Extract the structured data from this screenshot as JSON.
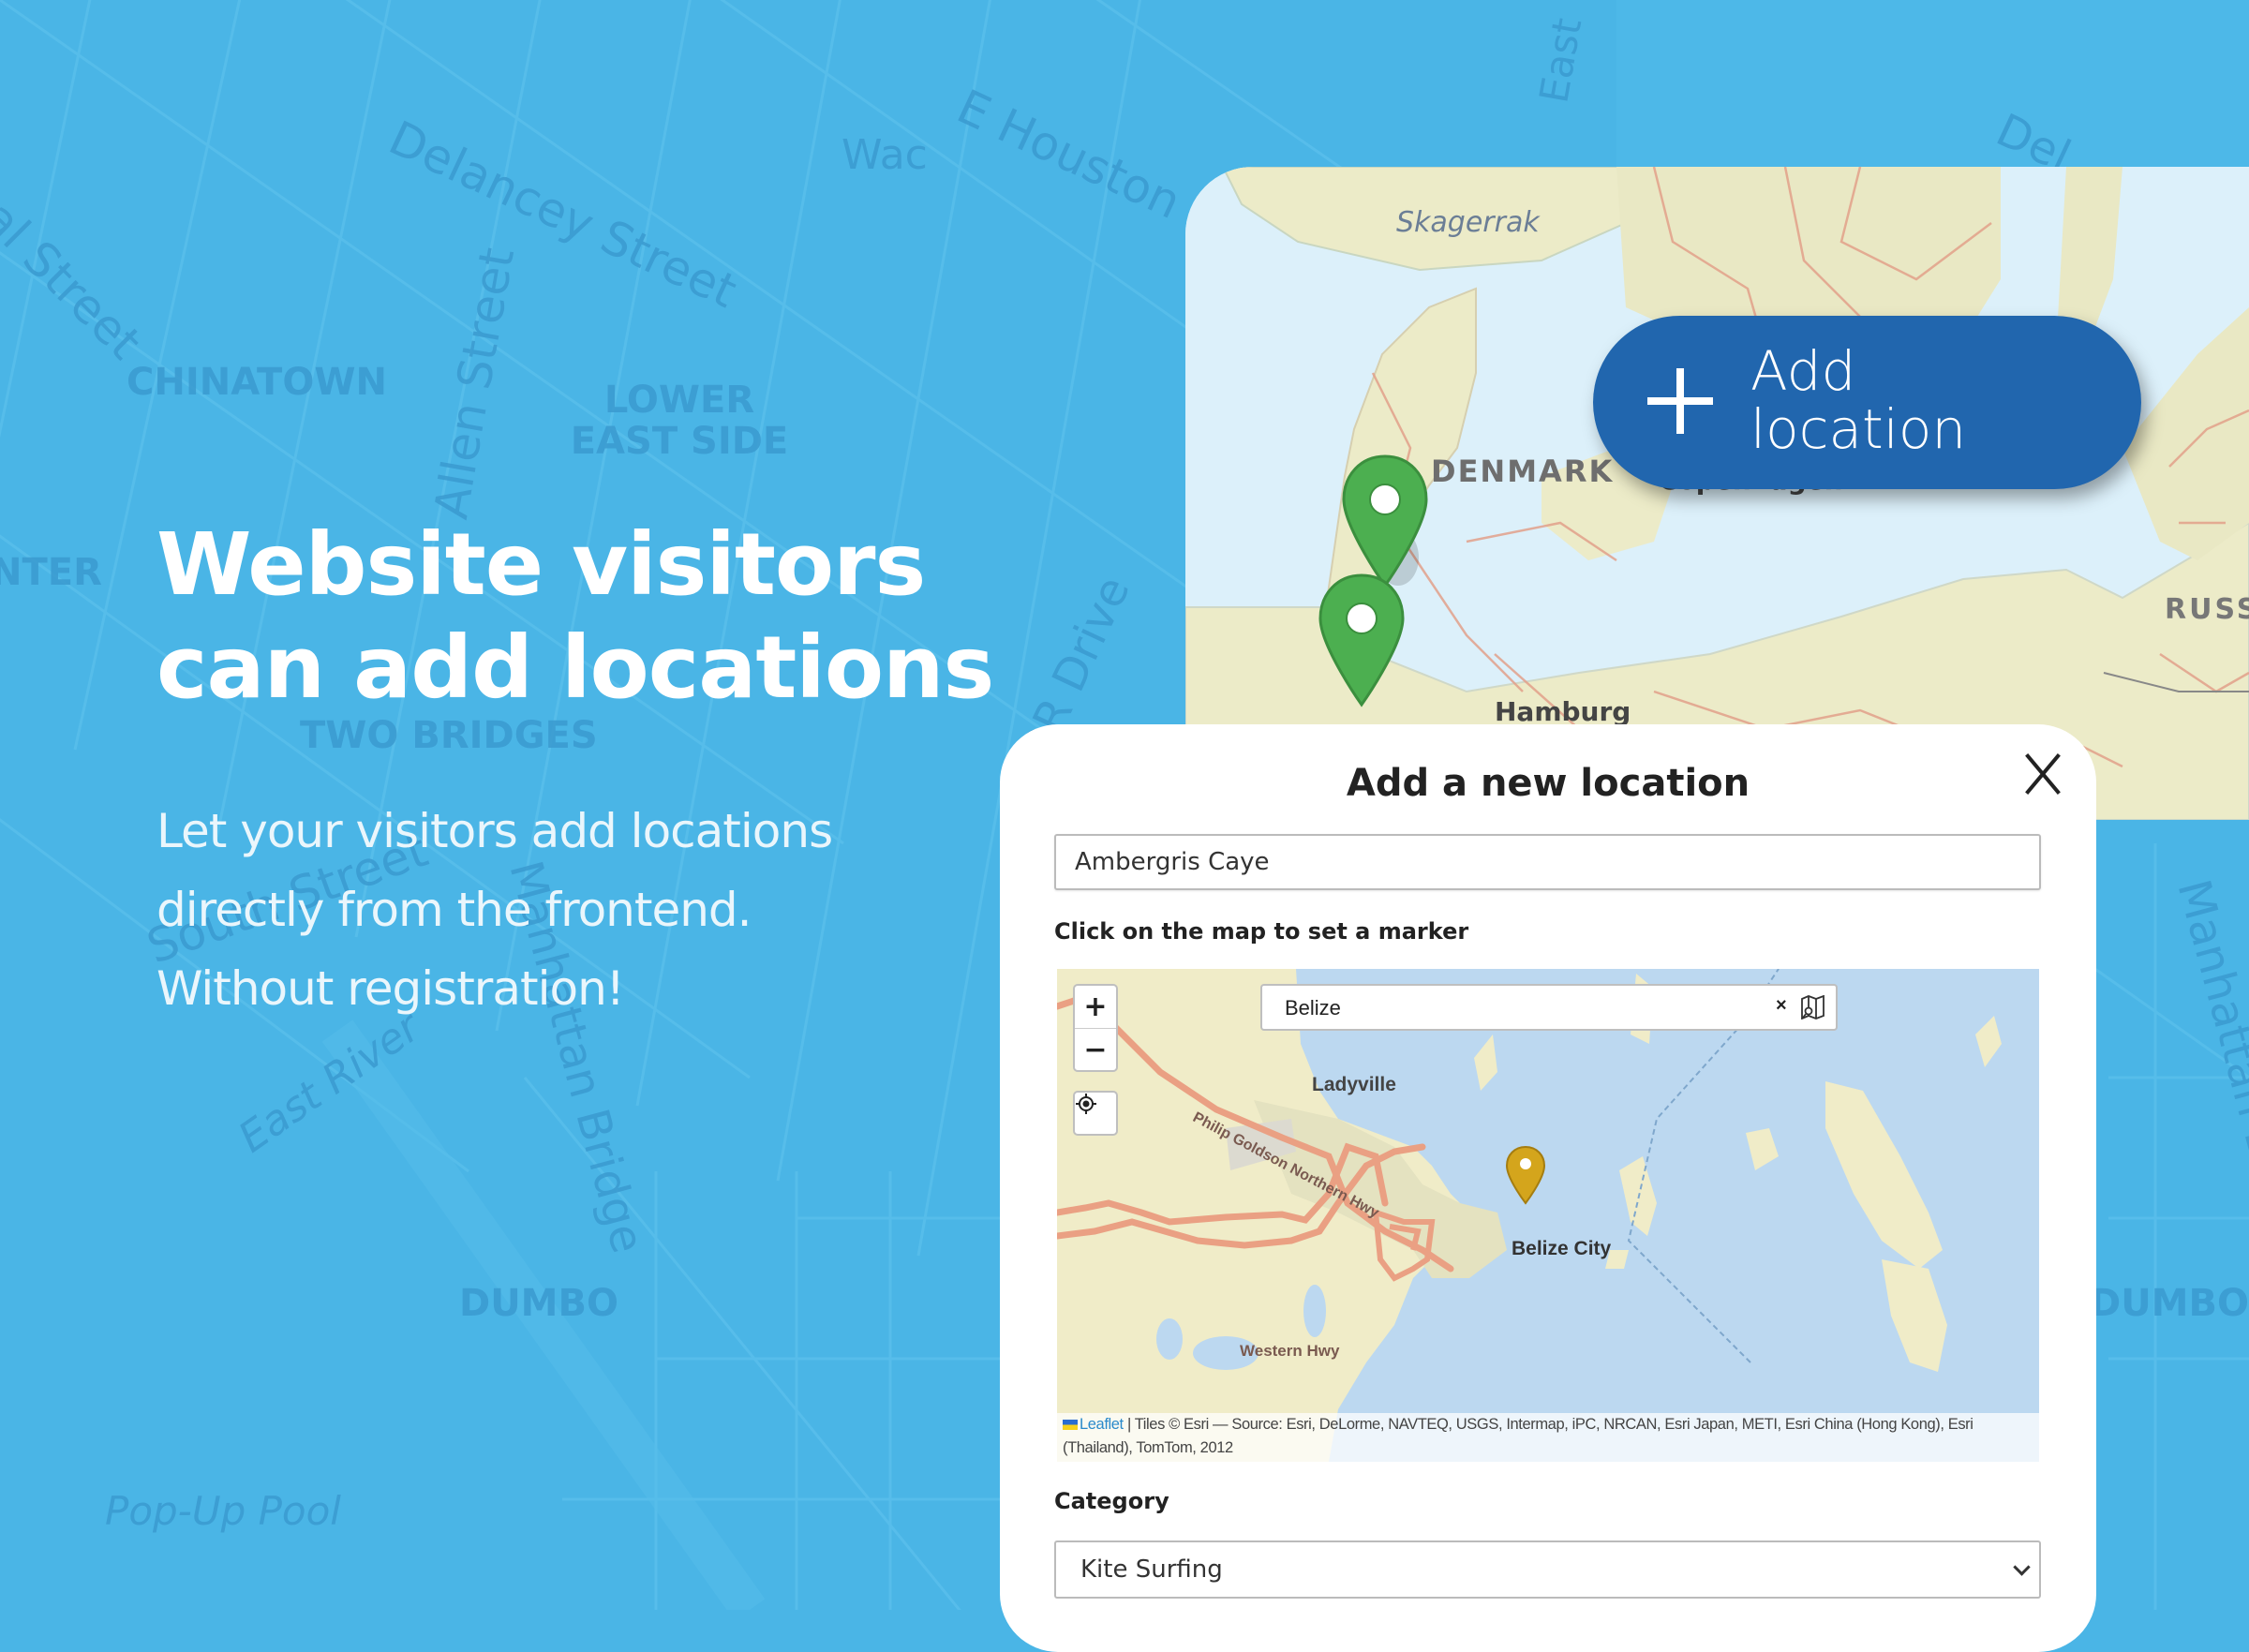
{
  "background_map": {
    "labels": [
      "Delancey Street",
      "E Houston St",
      "Wac",
      "East",
      "al Street",
      "Allen Street",
      "CHINATOWN",
      "LOWER EAST SIDE",
      "NTER",
      "TWO BRIDGES",
      "South Street",
      "FDR Drive",
      "East River",
      "Manhattan Bridge",
      "DUMBO",
      "Pop-Up Pool",
      "Del"
    ]
  },
  "hero": {
    "headline_line1": "Website visitors",
    "headline_line2": "can add locations",
    "sub_line1": "Let your visitors add locations",
    "sub_line2": "directly from the frontend.",
    "sub_line3": "Without registration!"
  },
  "preview_map": {
    "labels": [
      "Skagerrak",
      "DENMARK",
      "Copenhagen",
      "Hamburg",
      "RUSS"
    ],
    "add_button": {
      "line1": "Add",
      "line2": "location",
      "icon": "plus-icon",
      "color": "#2166ae"
    },
    "marker_color": "#4caf50"
  },
  "modal": {
    "title": "Add a new location",
    "close_icon": "close-icon",
    "name_input": {
      "value": "Ambergris Caye"
    },
    "map_instruction": "Click on the map to set a marker",
    "map": {
      "zoom_in": "+",
      "zoom_out": "−",
      "search": {
        "value": "Belize",
        "clear": "×"
      },
      "labels": [
        "Ladyville",
        "Philip Goldson Northern Hwy",
        "Belize City",
        "Western Hwy"
      ],
      "marker_color": "#d4a51c",
      "attribution": {
        "leaflet": "Leaflet",
        "text": "| Tiles © Esri — Source: Esri, DeLorme, NAVTEQ, USGS, Intermap, iPC, NRCAN, Esri Japan, METI, Esri China (Hong Kong), Esri (Thailand), TomTom, 2012"
      }
    },
    "category_label": "Category",
    "category_select": {
      "value": "Kite Surfing"
    }
  }
}
